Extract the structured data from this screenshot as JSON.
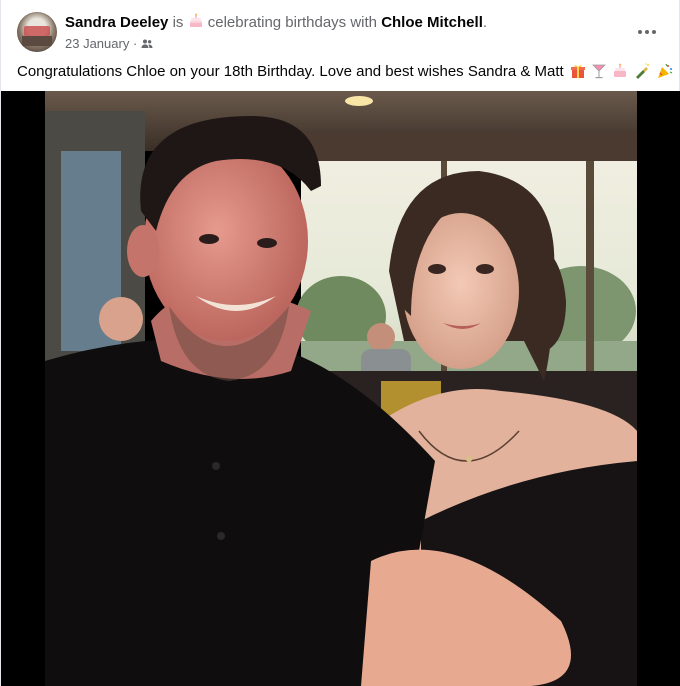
{
  "post": {
    "author": "Sandra Deeley",
    "activity_prefix": "is",
    "activity_text": "celebrating birthdays with",
    "tagged_person": "Chloe Mitchell",
    "tagged_suffix": ".",
    "date": "23 January",
    "date_separator": "·",
    "audience_icon": "friends-icon",
    "caption": "Congratulations Chloe on your 18th Birthday. Love and best wishes Sandra & Matt",
    "caption_emojis": [
      "gift-icon",
      "cocktail-glass-icon",
      "birthday-cake-icon",
      "champagne-bottle-icon",
      "party-popper-icon"
    ],
    "photo_icon": "post-photo"
  },
  "colors": {
    "text_primary": "#050505",
    "text_secondary": "#65676b",
    "photo_letterbox": "#000000"
  }
}
